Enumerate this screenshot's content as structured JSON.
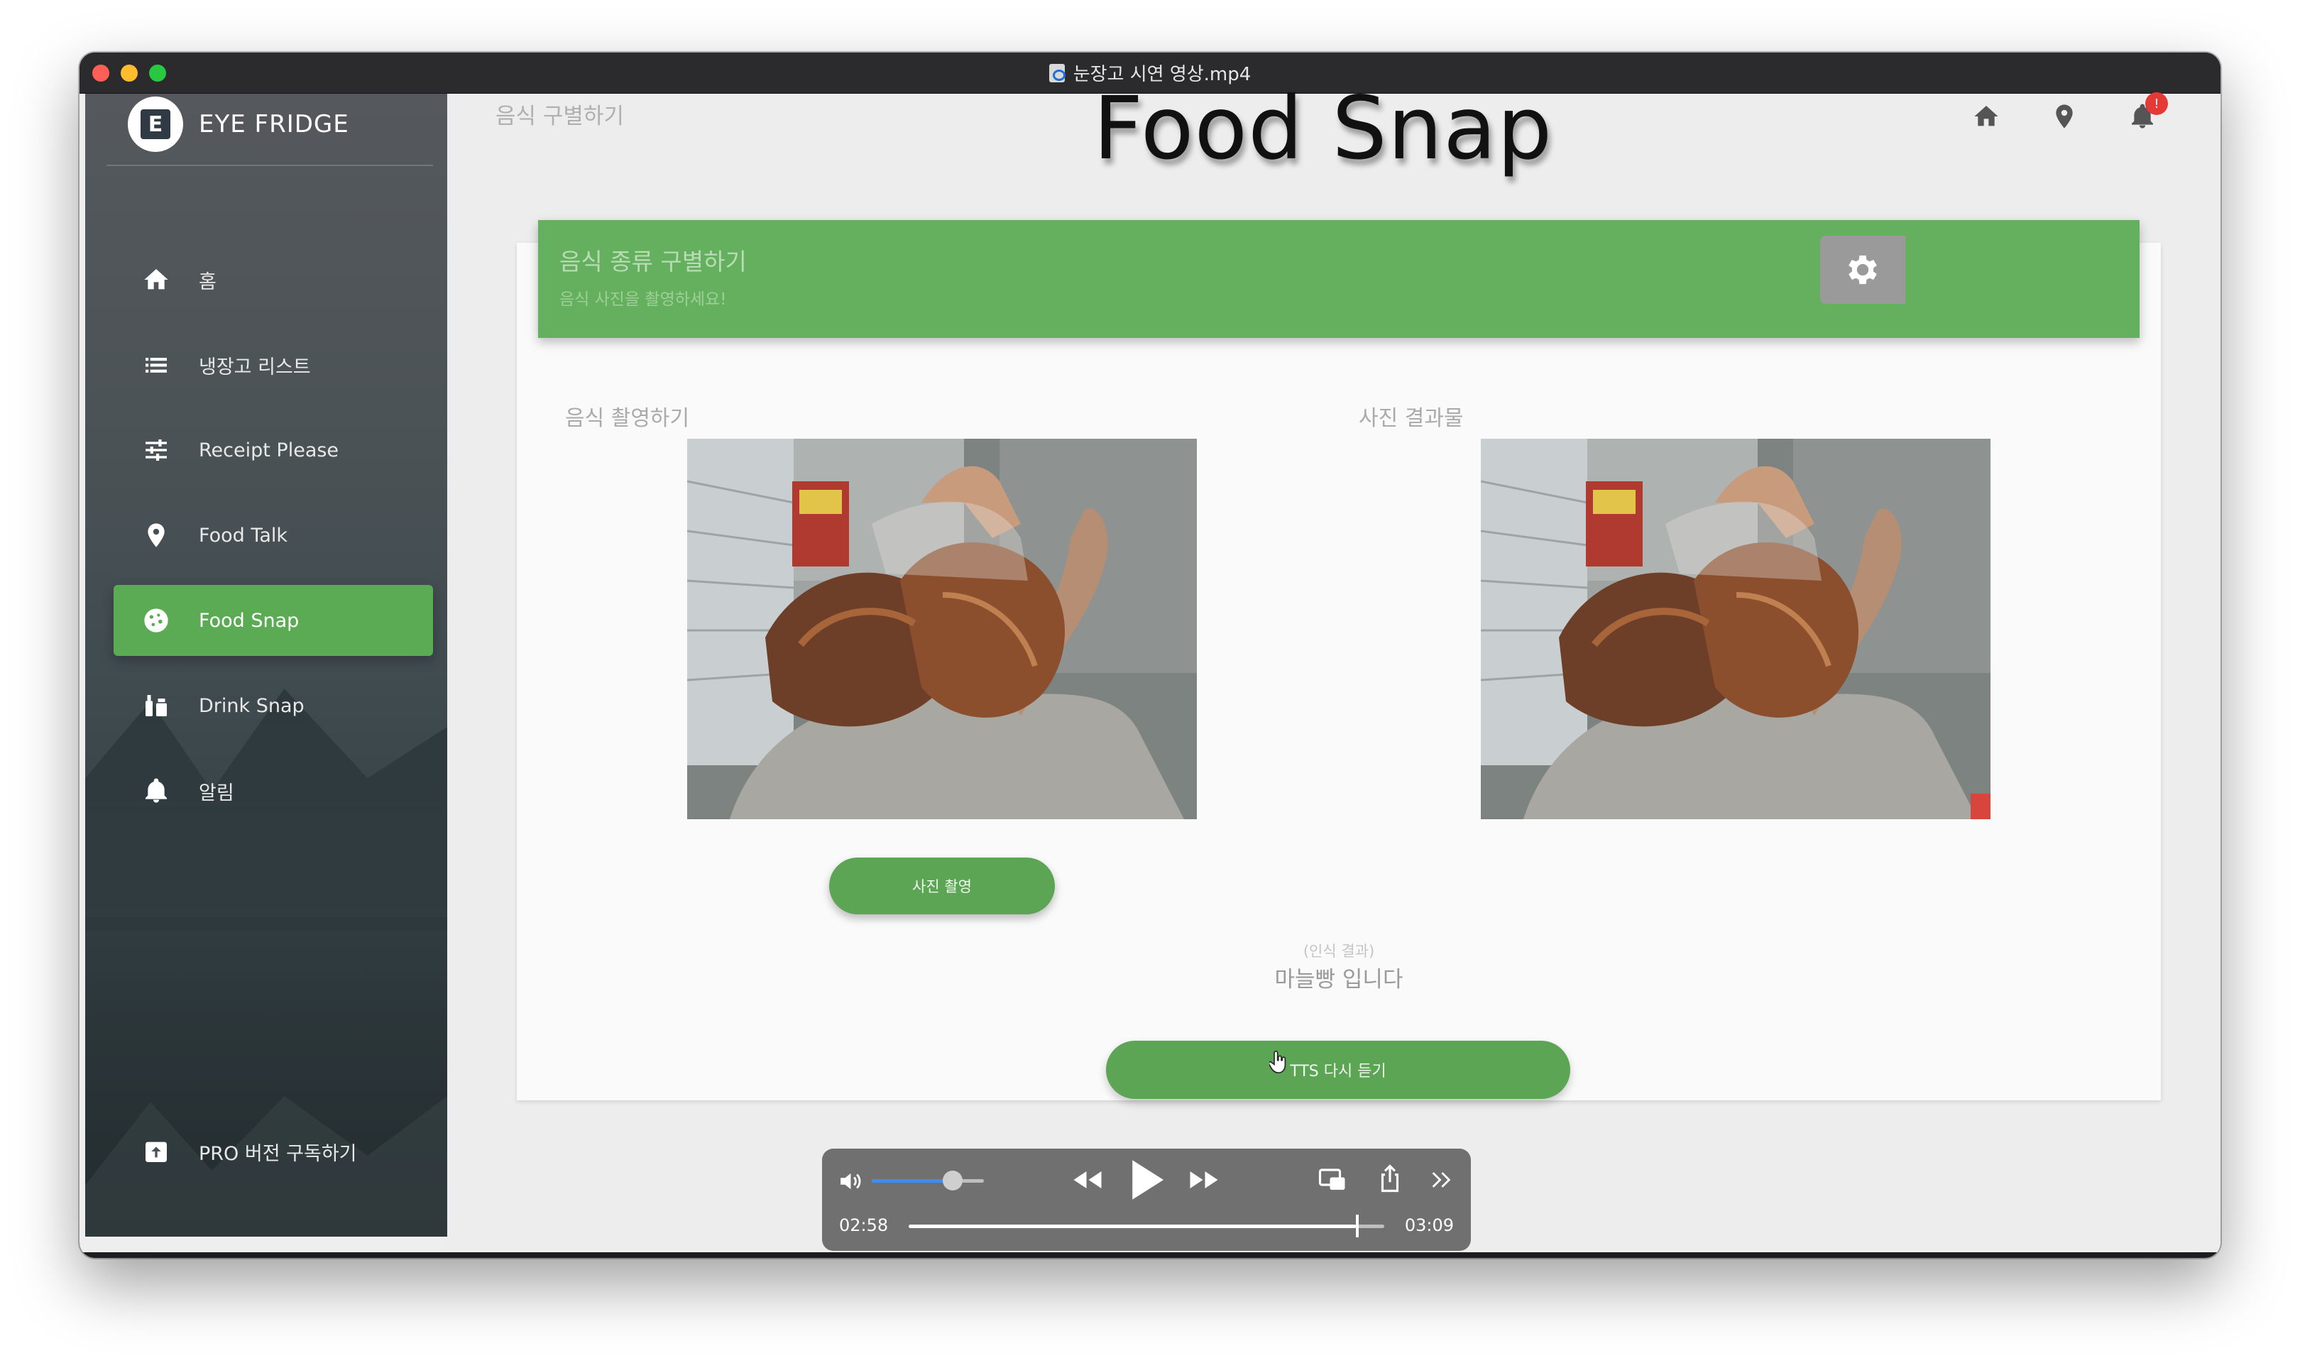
{
  "window": {
    "title": "눈장고 시연 영상.mp4"
  },
  "sidebar": {
    "brand_letter": "E",
    "brand_name": "EYE FRIDGE",
    "items": [
      {
        "label": "홈",
        "icon": "home-icon"
      },
      {
        "label": "냉장고 리스트",
        "icon": "list-icon"
      },
      {
        "label": "Receipt Please",
        "icon": "tune-icon"
      },
      {
        "label": "Food Talk",
        "icon": "location-pin-icon"
      },
      {
        "label": "Food Snap",
        "icon": "cookie-icon",
        "active": true
      },
      {
        "label": "Drink Snap",
        "icon": "drink-icon"
      },
      {
        "label": "알림",
        "icon": "bell-icon"
      }
    ],
    "pro_label": "PRO 버전 구독하기"
  },
  "header": {
    "breadcrumb": "음식 구별하기",
    "title": "Food Snap",
    "notification_count": "!"
  },
  "card": {
    "title": "음식 종류 구별하기",
    "subtitle": "음식 사진을 촬영하세요!",
    "left_label": "음식 촬영하기",
    "right_label": "사진 결과물",
    "capture_button": "사진 촬영",
    "result_caption": "(인식 결과)",
    "result_text": "마늘빵 입니다",
    "tts_button": "TTS 다시 듣기"
  },
  "player": {
    "current_time": "02:58",
    "total_time": "03:09",
    "progress": 0.94,
    "volume": 0.72
  },
  "colors": {
    "accent_green": "#5bab55",
    "header_green": "#64b05e",
    "badge_red": "#e53935",
    "volume_blue": "#3d8df5"
  }
}
